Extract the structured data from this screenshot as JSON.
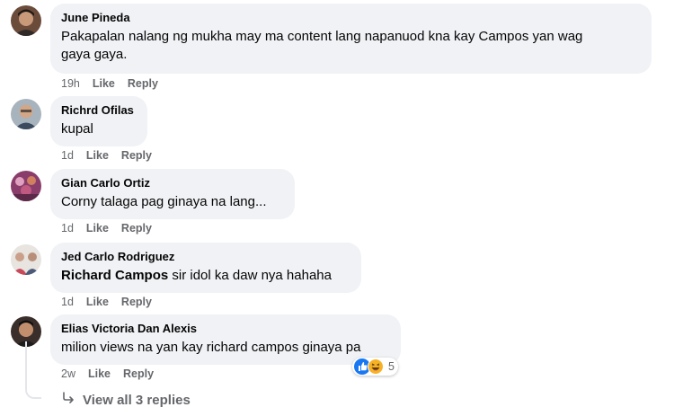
{
  "comments": [
    {
      "author": "June Pineda",
      "text_line1": "Pakapalan nalang ng mukha may ma content lang napanuod kna kay Campos yan wag",
      "text_line2": "gaya gaya.",
      "time": "19h",
      "like": "Like",
      "reply": "Reply"
    },
    {
      "author": "Richrd Ofilas",
      "text": "kupal",
      "time": "1d",
      "like": "Like",
      "reply": "Reply"
    },
    {
      "author": "Gian Carlo Ortiz",
      "text": "Corny talaga pag ginaya na lang...",
      "time": "1d",
      "like": "Like",
      "reply": "Reply"
    },
    {
      "author": "Jed Carlo Rodriguez",
      "mention": "Richard Campos",
      "text": " sir idol ka daw nya hahaha",
      "time": "1d",
      "like": "Like",
      "reply": "Reply"
    },
    {
      "author": "Elias Victoria Dan Alexis",
      "text": "milion views na yan kay richard campos ginaya pa",
      "time": "2w",
      "like": "Like",
      "reply": "Reply",
      "reaction_count": "5",
      "reactions": [
        "like-reaction",
        "haha-reaction"
      ]
    }
  ],
  "view_replies": "View all 3 replies",
  "colors": {
    "bubble": "#f0f2f5",
    "meta": "#65676b",
    "like_blue": "#1877f2",
    "haha_yellow": "#f7b125"
  }
}
